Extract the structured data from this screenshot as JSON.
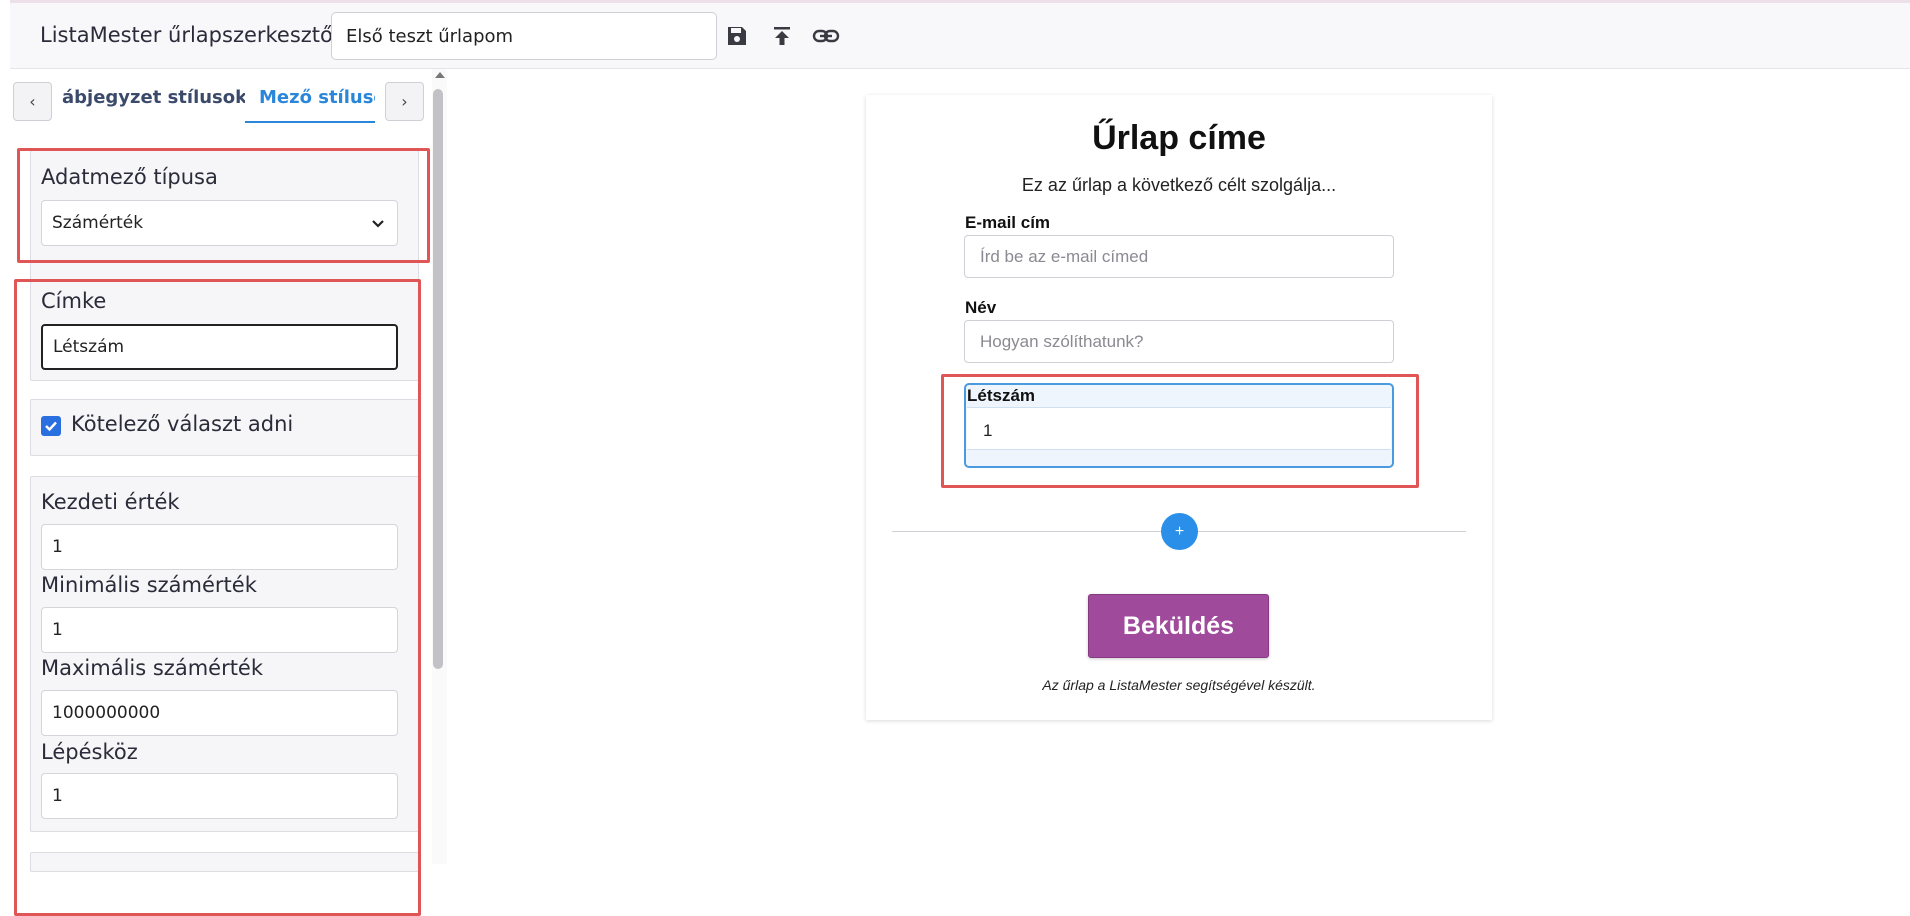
{
  "topbar": {
    "app_title": "ListaMester űrlapszerkesztő:",
    "form_name_value": "Első teszt űrlapom"
  },
  "tabs": {
    "prev_label": "‹",
    "next_label": "›",
    "items": [
      {
        "label": "ábjegyzet stílusok"
      },
      {
        "label": "Mező stílusok"
      }
    ]
  },
  "settings": {
    "field_type": {
      "label": "Adatmező típusa",
      "value": "Számérték"
    },
    "label_field": {
      "label": "Címke",
      "value": "Létszám"
    },
    "required": {
      "label": "Kötelező választ adni",
      "checked": true
    },
    "initial_value": {
      "label": "Kezdeti érték",
      "value": "1"
    },
    "min_value": {
      "label": "Minimális számérték",
      "value": "1"
    },
    "max_value": {
      "label": "Maximális számérték",
      "value": "1000000000"
    },
    "step": {
      "label": "Lépésköz",
      "value": "1"
    }
  },
  "preview": {
    "title": "Űrlap címe",
    "subtitle": "Ez az űrlap a következő célt szolgálja...",
    "fields": [
      {
        "label": "E-mail cím",
        "placeholder": "Írd be az e-mail címed"
      },
      {
        "label": "Név",
        "placeholder": "Hogyan szólíthatunk?"
      }
    ],
    "selected_field": {
      "label": "Létszám",
      "value": "1"
    },
    "add_button_label": "+",
    "submit_label": "Beküldés",
    "footer": "Az űrlap a ListaMester segítségével készült."
  },
  "colors": {
    "accent_blue": "#2a86d9",
    "submit_purple": "#a04a9c",
    "highlight_red": "#e05555"
  }
}
